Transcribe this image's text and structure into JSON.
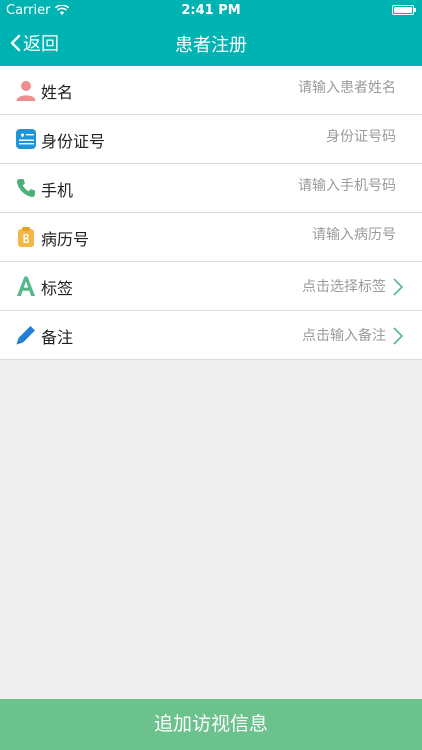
{
  "status_bar": {
    "carrier": "Carrier",
    "time": "2:41 PM"
  },
  "nav": {
    "back_label": "返回",
    "title": "患者注册"
  },
  "form": {
    "rows": [
      {
        "label": "姓名",
        "placeholder": "请输入患者姓名",
        "icon": "person-icon"
      },
      {
        "label": "身份证号",
        "placeholder": "身份证号码",
        "icon": "id-card-icon"
      },
      {
        "label": "手机",
        "placeholder": "请输入手机号码",
        "icon": "phone-icon"
      },
      {
        "label": "病历号",
        "placeholder": "请输入病历号",
        "icon": "medical-record-icon"
      },
      {
        "label": "标签",
        "value": "点击选择标签",
        "icon": "tag-letter-icon"
      },
      {
        "label": "备注",
        "value": "点击输入备注",
        "icon": "pencil-icon"
      }
    ]
  },
  "submit_label": "追加访视信息",
  "colors": {
    "header": "#00b3b3",
    "submit": "#6cc28c",
    "background": "#efefef"
  }
}
